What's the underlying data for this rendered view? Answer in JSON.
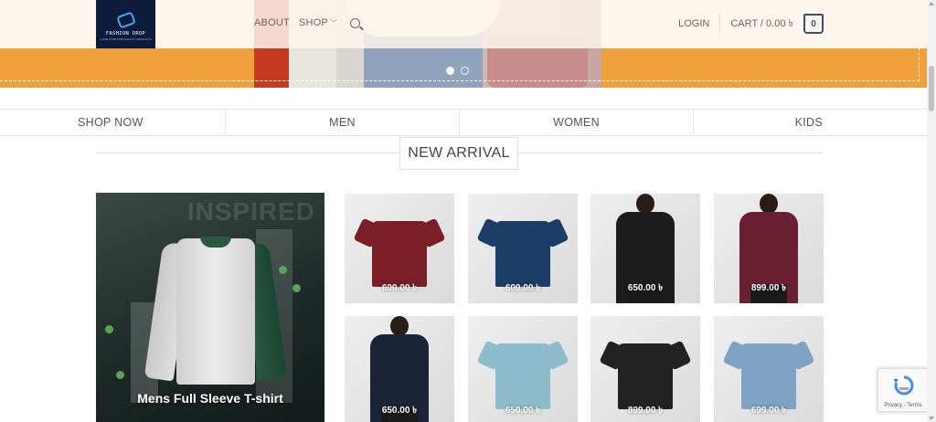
{
  "header": {
    "logo": {
      "text": "FASHION DROP",
      "tagline": "A ONE STOP FOR QUALITY PRODUCTS"
    },
    "nav": {
      "about": "ABOUT",
      "shop": "SHOP",
      "search_icon": "search-icon",
      "chevron_icon": "chevron-down-icon"
    },
    "login": "LOGIN",
    "cart": {
      "label": "CART / 0.00 ৳",
      "count": "0"
    }
  },
  "hero": {
    "slides": 2,
    "active_slide": 1
  },
  "categories": [
    "SHOP NOW",
    "MEN",
    "WOMEN",
    "KIDS"
  ],
  "section": {
    "title": "NEW ARRIVAL"
  },
  "featured": {
    "name": "Mens Full Sleeve T-shirt",
    "bg_text": "INSPIRED"
  },
  "products": [
    {
      "price": "600.00 ৳",
      "kind": "tee",
      "color": "#7a1f25"
    },
    {
      "price": "600.00 ৳",
      "kind": "tee",
      "color": "#1c3d66"
    },
    {
      "price": "650.00 ৳",
      "kind": "top",
      "color": "#1d1d1d"
    },
    {
      "price": "899.00 ৳",
      "kind": "dress",
      "color": "#6b1f33"
    },
    {
      "price": "650.00 ৳",
      "kind": "top",
      "color": "#1d2438"
    },
    {
      "price": "650.00 ৳",
      "kind": "polo",
      "color": "#8fbccd"
    },
    {
      "price": "899.00 ৳",
      "kind": "tee",
      "color": "#222222"
    },
    {
      "price": "699.00 ৳",
      "kind": "tee",
      "color": "#7ea3c4"
    }
  ],
  "recaptcha": {
    "links": "Privacy - Terms"
  },
  "colors": {
    "accent_orange": "#f0a03a",
    "navy": "#0d1c3d",
    "cart_border": "#3b4f75"
  }
}
